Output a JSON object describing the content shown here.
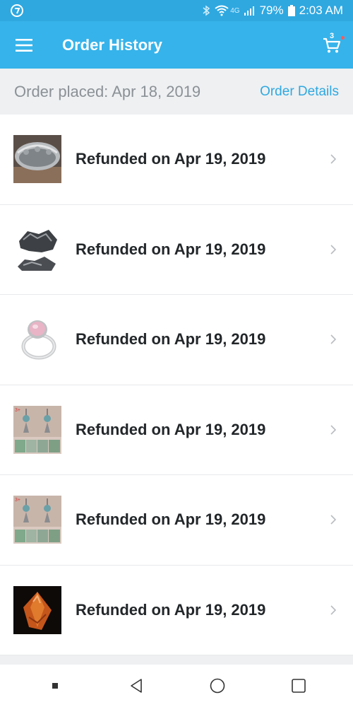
{
  "status_bar": {
    "network_label": "4G",
    "battery": "79%",
    "time": "2:03 AM"
  },
  "app_bar": {
    "title": "Order History",
    "cart_count": "3"
  },
  "order": {
    "placed_label": "Order placed: Apr 18, 2019",
    "details_link": "Order Details"
  },
  "items": [
    {
      "text": "Refunded on Apr 19, 2019",
      "image": "silver-cuff-bracelet"
    },
    {
      "text": "Refunded on Apr 19, 2019",
      "image": "dark-mineral-stones"
    },
    {
      "text": "Refunded on Apr 19, 2019",
      "image": "pink-stone-ring"
    },
    {
      "text": "Refunded on Apr 19, 2019",
      "image": "earrings-set"
    },
    {
      "text": "Refunded on Apr 19, 2019",
      "image": "earrings-set"
    },
    {
      "text": "Refunded on Apr 19, 2019",
      "image": "orange-gem-pendant"
    }
  ],
  "icons": {
    "menu": "hamburger-menu-icon",
    "cart": "shopping-cart-icon",
    "chevron": "chevron-right-icon",
    "back": "back-triangle-icon",
    "home": "home-circle-icon",
    "recents": "recents-square-icon"
  },
  "colors": {
    "app_bar": "#36b3ea",
    "status_bar": "#2fa8e0",
    "link": "#2fa8e0",
    "text": "#23272a",
    "muted": "#8b9196"
  }
}
